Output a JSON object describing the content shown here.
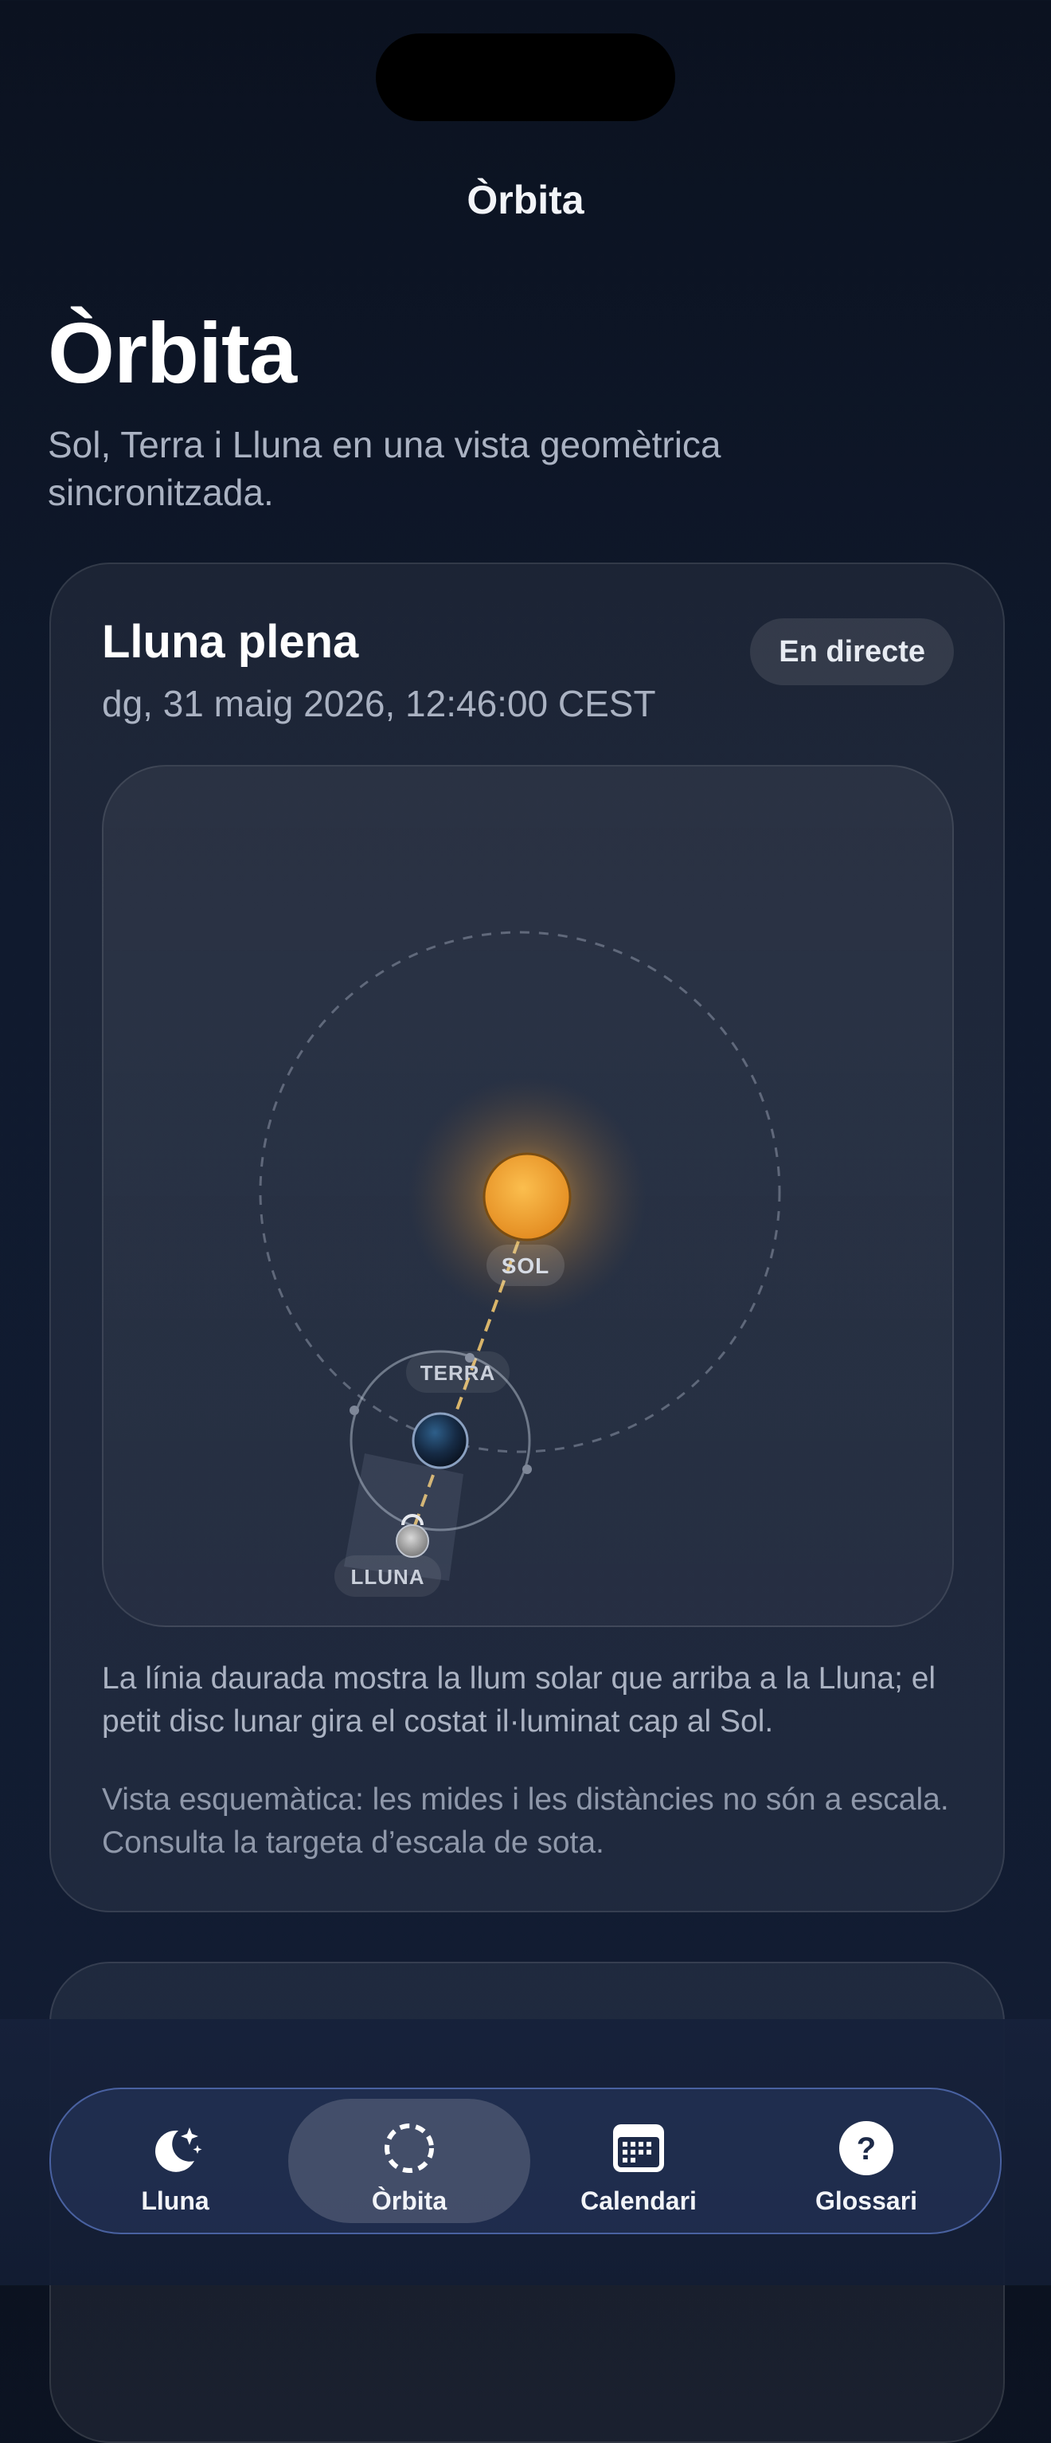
{
  "header": {
    "nav_title": "Òrbita",
    "large_title": "Òrbita",
    "subtitle": "Sol, Terra i Lluna en una vista geomètrica sincronitzada."
  },
  "orbit_card": {
    "phase_title": "Lluna plena",
    "datetime": "dg, 31 maig 2026, 12:46:00 CEST",
    "live_label": "En directe",
    "labels": {
      "sun": "SOL",
      "earth": "TERRA",
      "moon": "LLUNA"
    },
    "description": "La línia daurada mostra la llum solar que arriba a la Lluna; el petit disc lunar gira el costat il·luminat cap al Sol.",
    "note": "Vista esquemàtica: les mides i les distàncies no són a escala. Consulta la targeta d’escala de sota."
  },
  "tabs": [
    {
      "label": "Lluna",
      "icon": "moon-stars-icon",
      "active": false
    },
    {
      "label": "Òrbita",
      "icon": "orbit-icon",
      "active": true
    },
    {
      "label": "Calendari",
      "icon": "calendar-icon",
      "active": false
    },
    {
      "label": "Glossari",
      "icon": "question-icon",
      "active": false
    }
  ],
  "colors": {
    "sun": "#f3a73b",
    "sunlight_line": "#d9b56a",
    "active_tab_border": "#6e8ce6"
  }
}
